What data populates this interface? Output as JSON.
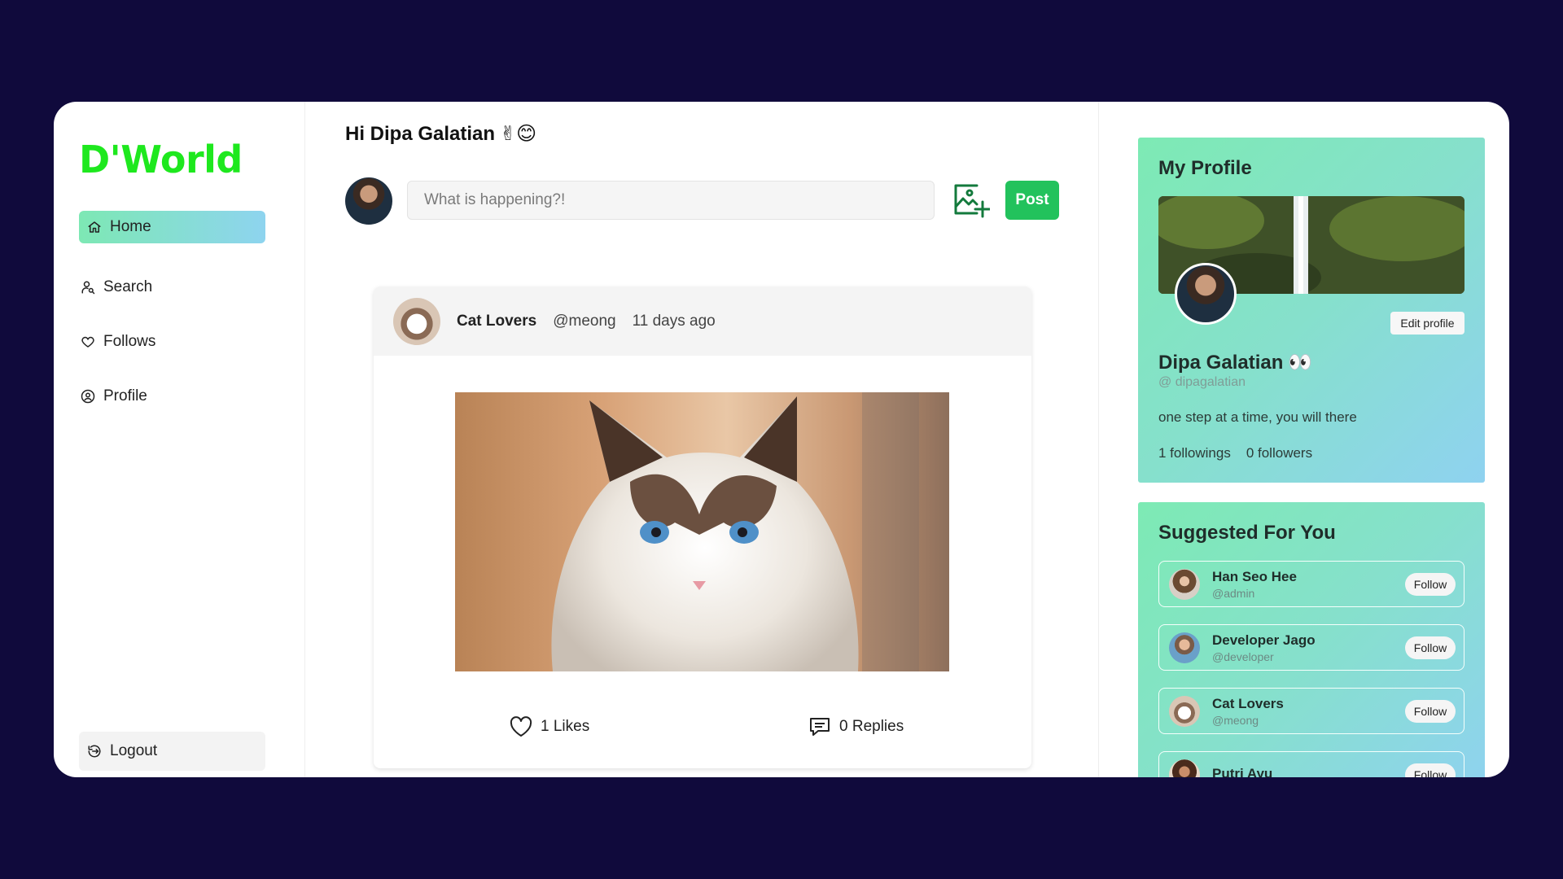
{
  "app": {
    "logo": "D'World"
  },
  "sidebar": {
    "items": [
      {
        "label": "Home",
        "icon": "home-icon",
        "active": true
      },
      {
        "label": "Search",
        "icon": "user-search-icon"
      },
      {
        "label": "Follows",
        "icon": "heart-icon"
      },
      {
        "label": "Profile",
        "icon": "user-circle-icon"
      }
    ],
    "logout_label": "Logout"
  },
  "main": {
    "greeting": "Hi Dipa Galatian",
    "greeting_emoji": "✌😊",
    "compose": {
      "placeholder": "What is happening?!",
      "value": "",
      "post_label": "Post"
    },
    "posts": [
      {
        "author": "Cat Lovers",
        "handle": "@meong",
        "time": "11 days ago",
        "likes_label": "1 Likes",
        "replies_label": "0 Replies"
      }
    ]
  },
  "profile": {
    "title": "My Profile",
    "name": "Dipa Galatian",
    "name_emoji": "👀",
    "handle": "@ dipagalatian",
    "bio": "one step at a time, you will there",
    "followings": "1 followings",
    "followers": "0 followers",
    "edit_label": "Edit profile"
  },
  "suggested": {
    "title": "Suggested For You",
    "items": [
      {
        "name": "Han Seo Hee",
        "handle": "@admin",
        "follow_label": "Follow"
      },
      {
        "name": "Developer Jago",
        "handle": "@developer",
        "follow_label": "Follow"
      },
      {
        "name": "Cat Lovers",
        "handle": "@meong",
        "follow_label": "Follow"
      },
      {
        "name": "Putri Ayu",
        "handle": "",
        "follow_label": "Follow"
      }
    ]
  },
  "colors": {
    "background": "#100a3c",
    "logo": "#1ee81e",
    "post_button": "#22c25c",
    "panel_gradient_start": "#7deab4",
    "panel_gradient_end": "#8fd2f0"
  }
}
